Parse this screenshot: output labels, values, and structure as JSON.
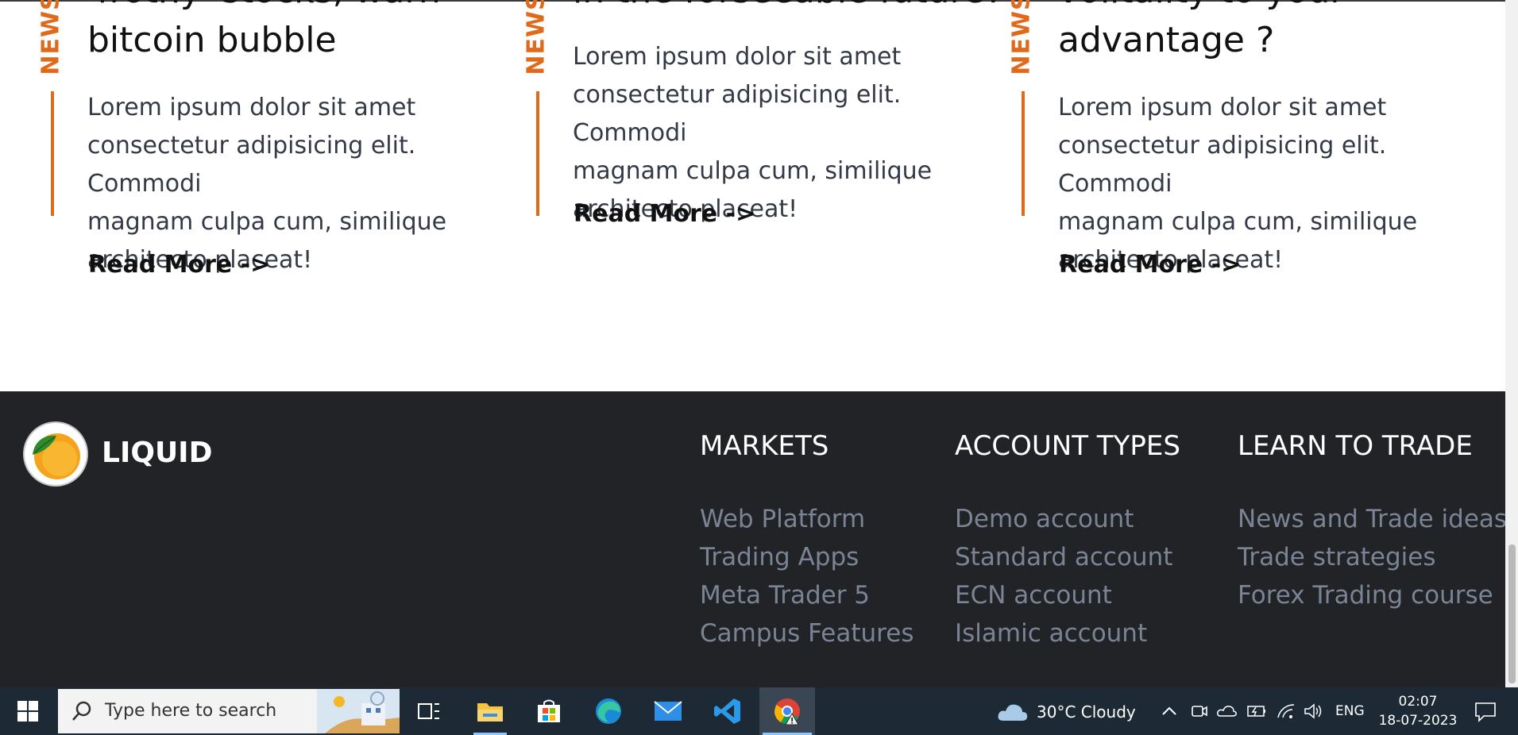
{
  "news": [
    {
      "tag": "NEWS",
      "title_lines": [
        "'frothy' stocks, warn",
        "bitcoin bubble"
      ],
      "body_lines": [
        "Lorem ipsum dolor sit amet",
        "consectetur adipisicing elit. Commodi",
        "magnam culpa cum, similique",
        "architecto placeat!"
      ],
      "read_more": "Read More ->"
    },
    {
      "tag": "NEWS",
      "title_lines": [
        "in the forseeable future?"
      ],
      "body_lines": [
        "Lorem ipsum dolor sit amet",
        "consectetur adipisicing elit. Commodi",
        "magnam culpa cum, similique",
        "architecto placeat!"
      ],
      "read_more": "Read More ->"
    },
    {
      "tag": "NEWS",
      "title_lines": [
        "volitality to your",
        "advantage ?"
      ],
      "body_lines": [
        "Lorem ipsum dolor sit amet",
        "consectetur adipisicing elit. Commodi",
        "magnam culpa cum, similique",
        "architecto placeat!"
      ],
      "read_more": "Read More ->"
    }
  ],
  "footer": {
    "brand": "LIQUID",
    "columns": [
      {
        "heading": "MARKETS",
        "links": [
          "Web Platform",
          "Trading Apps",
          "Meta Trader 5",
          "Campus Features"
        ]
      },
      {
        "heading": "ACCOUNT TYPES",
        "links": [
          "Demo account",
          "Standard account",
          "ECN account",
          "Islamic account"
        ]
      },
      {
        "heading": "LEARN TO TRADE",
        "links": [
          "News and Trade ideas",
          "Trade strategies",
          "Forex Trading course"
        ]
      }
    ]
  },
  "taskbar": {
    "search_placeholder": "Type here to search",
    "weather": "30°C  Cloudy",
    "language": "ENG",
    "time": "02:07",
    "date": "18-07-2023",
    "pinned_apps": [
      "task-view-icon",
      "file-explorer-icon",
      "microsoft-store-icon",
      "edge-icon",
      "mail-icon",
      "vscode-icon",
      "chrome-icon"
    ]
  },
  "colors": {
    "accent": "#e06a1c",
    "footer_bg": "#212326",
    "footer_link": "#7a8494",
    "taskbar_bg": "#1d2a36"
  }
}
